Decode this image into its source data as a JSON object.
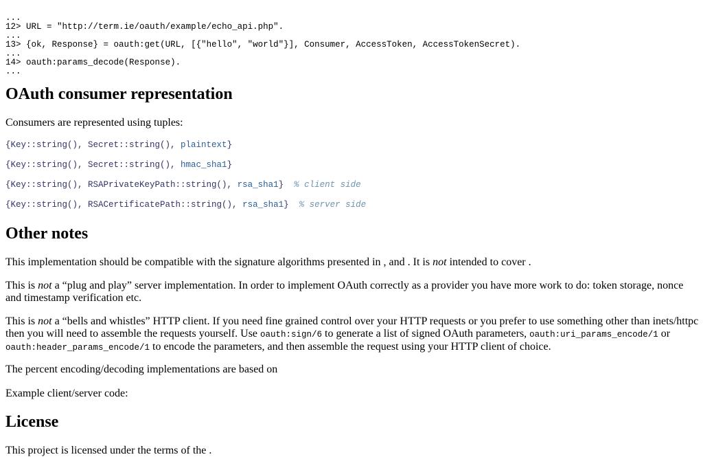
{
  "shell": {
    "dots_1": "...",
    "line_12_prompt": "12>",
    "line_12_code": "URL = \"http://term.ie/oauth/example/echo_api.php\".",
    "dots_2": "...",
    "line_13_prompt": "13>",
    "line_13_code": "{ok, Response} = oauth:get(URL, [{\"hello\", \"world\"}], Consumer, AccessToken, AccessTokenSecret).",
    "dots_3": "...",
    "line_14_prompt": "14>",
    "line_14_code": "oauth:params_decode(Response).",
    "dots_4": "..."
  },
  "consumer_section": {
    "heading": "OAuth consumer representation",
    "intro": "Consumers are represented using tuples:",
    "tuples": [
      {
        "prefix": "{Key::string(), Secret::string(), ",
        "atom": "plaintext",
        "suffix": "}",
        "comment": ""
      },
      {
        "prefix": "{Key::string(), Secret::string(), ",
        "atom": "hmac_sha1",
        "suffix": "}",
        "comment": ""
      },
      {
        "prefix": "{Key::string(), RSAPrivateKeyPath::string(), ",
        "atom": "rsa_sha1",
        "suffix": "}",
        "comment": "% client side"
      },
      {
        "prefix": "{Key::string(), RSACertificatePath::string(), ",
        "atom": "rsa_sha1",
        "suffix": "}",
        "comment": "% server side"
      }
    ]
  },
  "notes_section": {
    "heading": "Other notes",
    "p1_a": "This implementation should be compatible with the signature algorithms presented in , and . It is ",
    "p1_em": "not",
    "p1_b": " intended to cover .",
    "p2_a": "This is ",
    "p2_em": "not",
    "p2_b": " a “plug and play” server implementation. In order to implement OAuth correctly as a provider you have more work to do: token storage, nonce and timestamp verification etc.",
    "p3_a": "This is ",
    "p3_em": "not",
    "p3_b": " a “bells and whistles” HTTP client. If you need fine grained control over your HTTP requests or you prefer to use something other than inets/httpc then you will need to assemble the requests yourself. Use ",
    "p3_code1": "oauth:sign/6",
    "p3_c": " to generate a list of signed OAuth parameters, ",
    "p3_code2": "oauth:uri_params_encode/1",
    "p3_d": " or ",
    "p3_code3": "oauth:header_params_encode/1",
    "p3_e": " to encode the parameters, and then assemble the request using your HTTP client of choice.",
    "p4": "The percent encoding/decoding implementations are based on",
    "p5": "Example client/server code:"
  },
  "license_section": {
    "heading": "License",
    "text": "This project is licensed under the terms of the ."
  }
}
